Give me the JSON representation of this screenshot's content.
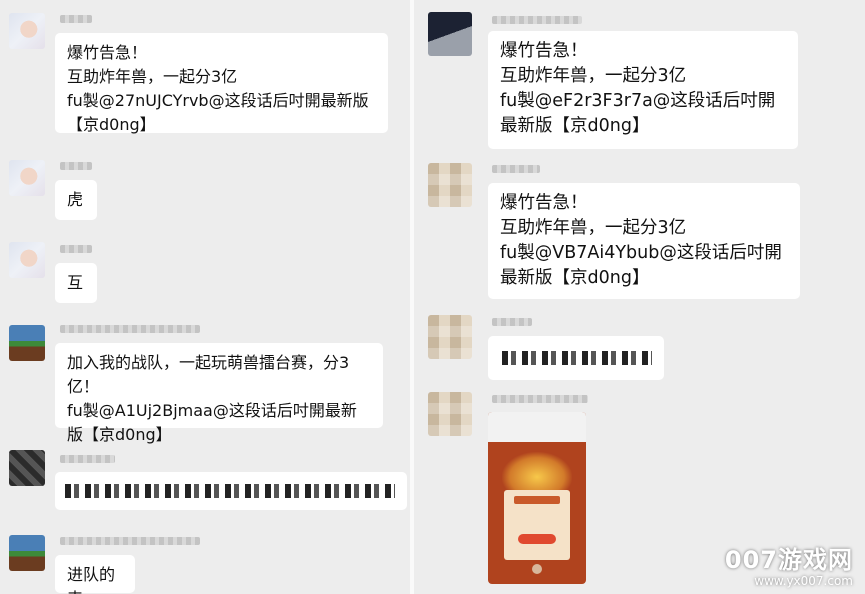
{
  "left_chat": {
    "messages": [
      {
        "text": "爆竹告急！\n互助炸年兽，一起分3亿\nfu製@27nUJCYrvb@这段话后吋開最新版【京d0ng】"
      },
      {
        "text": "虎"
      },
      {
        "text": "互"
      },
      {
        "text": "加入我的战队，一起玩萌兽擂台赛，分3亿！\nfu製@A1Uj2Bjmaa@这段话后吋開最新版【京d0ng】"
      },
      {
        "text": ""
      },
      {
        "text": "进队的来"
      }
    ]
  },
  "right_chat": {
    "messages": [
      {
        "text": "爆竹告急！\n互助炸年兽，一起分3亿\nfu製@eF2r3F3r7a@这段话后吋開\n最新版【京d0ng】"
      },
      {
        "text": "爆竹告急！\n互助炸年兽，一起分3亿\nfu製@VB7Ai4Ybub@这段话后吋開\n最新版【京d0ng】"
      },
      {
        "text": ""
      }
    ],
    "shared_image": {
      "label": "shared-game-screenshot"
    }
  },
  "watermark": {
    "title": "007游戏网",
    "url": "www.yx007.com"
  },
  "colors": {
    "background": "#ededed",
    "bubble": "#ffffff"
  }
}
